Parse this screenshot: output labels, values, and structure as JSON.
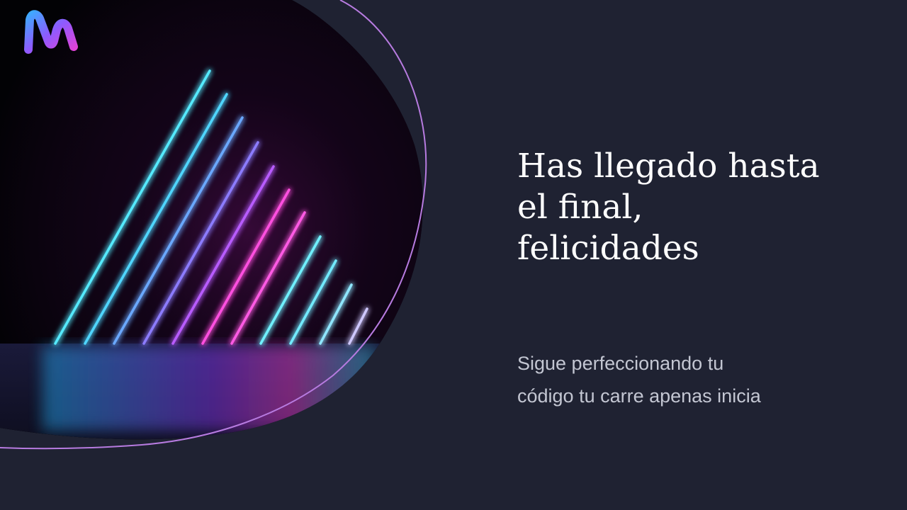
{
  "slide": {
    "title_lines": [
      "Has llegado hasta",
      "el final,",
      "felicidades"
    ],
    "subtitle_lines": [
      "Sigue perfeccionando tu",
      "código tu carre apenas inicia"
    ]
  },
  "theme": {
    "background": "#1f2232",
    "title_color": "#ffffff",
    "subtitle_color": "#c3c6d2",
    "accent_outline": "#b77be0",
    "neon_cyan": "#33e6ff",
    "neon_magenta": "#ff3fd6"
  },
  "icons": {
    "logo": "m-wave-logo-icon",
    "hero": "neon-lines-image"
  }
}
